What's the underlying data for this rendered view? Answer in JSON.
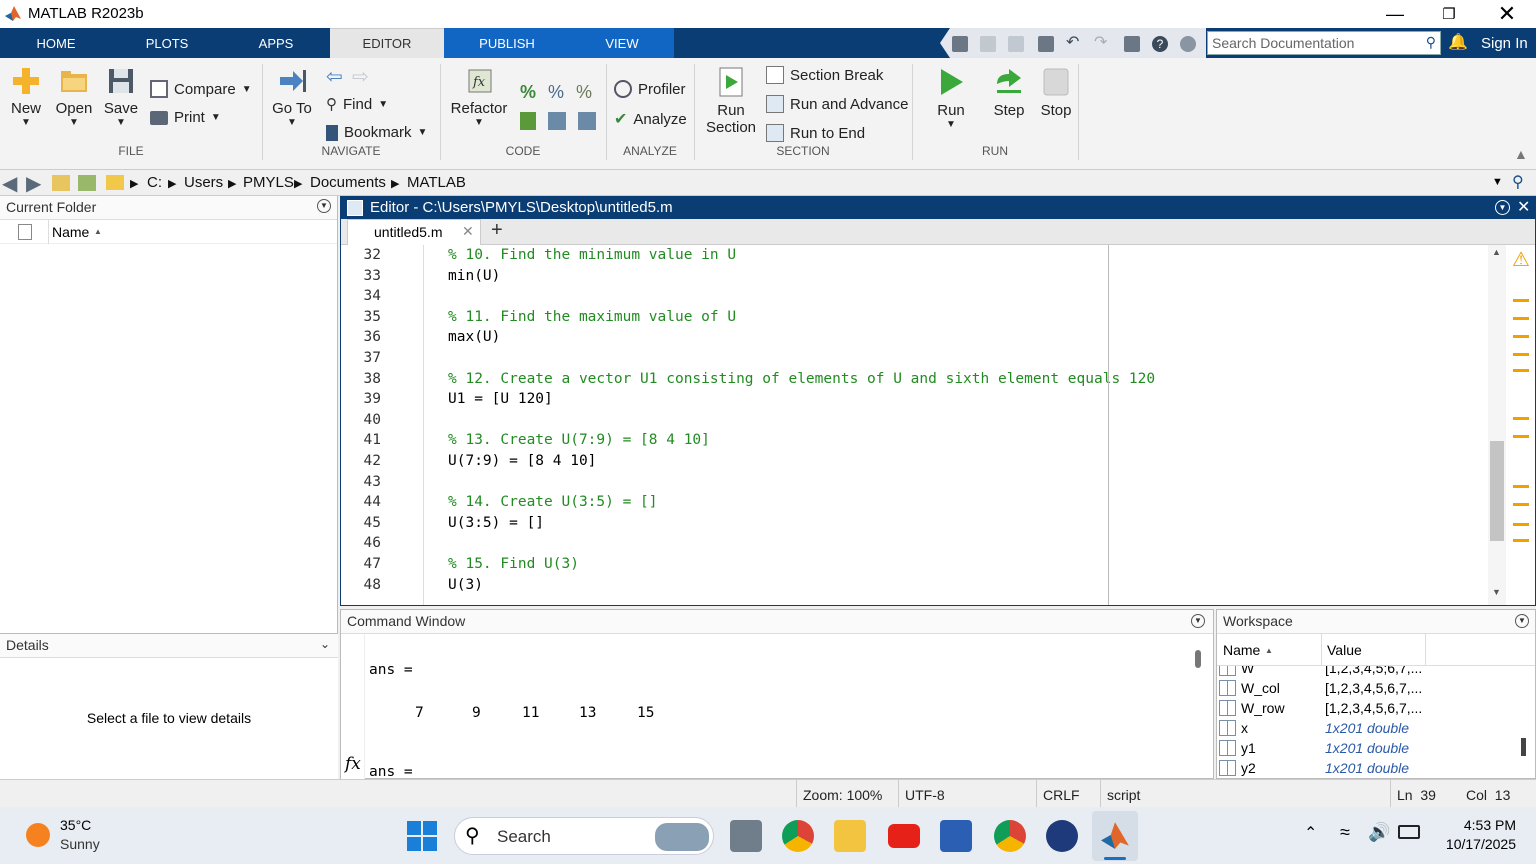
{
  "window": {
    "title": "MATLAB R2023b"
  },
  "ribbon_tabs": [
    "HOME",
    "PLOTS",
    "APPS",
    "EDITOR",
    "PUBLISH",
    "VIEW"
  ],
  "search": {
    "placeholder": "Search Documentation"
  },
  "sign_in": "Sign In",
  "ribbon": {
    "file": {
      "new": "New",
      "open": "Open",
      "save": "Save",
      "compare": "Compare",
      "print": "Print",
      "section": "FILE"
    },
    "navigate": {
      "goto": "Go To",
      "find": "Find",
      "bookmark": "Bookmark",
      "section": "NAVIGATE"
    },
    "code": {
      "refactor": "Refactor",
      "section": "CODE"
    },
    "analyze": {
      "profiler": "Profiler",
      "analyze": "Analyze",
      "section": "ANALYZE"
    },
    "section_grp": {
      "run_section": "Run",
      "run_section2": "Section",
      "section_break": "Section Break",
      "run_advance": "Run and Advance",
      "run_end": "Run to End",
      "section": "SECTION"
    },
    "run": {
      "run": "Run",
      "step": "Step",
      "stop": "Stop",
      "section": "RUN"
    }
  },
  "path": [
    "C:",
    "Users",
    "PMYLS",
    "Documents",
    "MATLAB"
  ],
  "current_folder": {
    "title": "Current Folder",
    "col_name": "Name"
  },
  "details": {
    "title": "Details",
    "message": "Select a file to view details"
  },
  "editor": {
    "title": "Editor - C:\\Users\\PMYLS\\Desktop\\untitled5.m",
    "tab": "untitled5.m",
    "lines": [
      {
        "n": "32",
        "text": "% 10. Find the minimum value in U",
        "cmt": true
      },
      {
        "n": "33",
        "text": "min(U)",
        "cmt": false
      },
      {
        "n": "34",
        "text": "",
        "cmt": false
      },
      {
        "n": "35",
        "text": "% 11. Find the maximum value of U",
        "cmt": true
      },
      {
        "n": "36",
        "text": "max(U)",
        "cmt": false
      },
      {
        "n": "37",
        "text": "",
        "cmt": false
      },
      {
        "n": "38",
        "text": "% 12. Create a vector U1 consisting of elements of U and sixth element equals 120",
        "cmt": true
      },
      {
        "n": "39",
        "text": "U1 = [U 120]",
        "cmt": false
      },
      {
        "n": "40",
        "text": "",
        "cmt": false
      },
      {
        "n": "41",
        "text": "% 13. Create U(7:9) = [8 4 10]",
        "cmt": true
      },
      {
        "n": "42",
        "text": "U(7:9) = [8 4 10]",
        "cmt": false
      },
      {
        "n": "43",
        "text": "",
        "cmt": false
      },
      {
        "n": "44",
        "text": "% 14. Create U(3:5) = []",
        "cmt": true
      },
      {
        "n": "45",
        "text": "U(3:5) = []",
        "cmt": false
      },
      {
        "n": "46",
        "text": "",
        "cmt": false
      },
      {
        "n": "47",
        "text": "% 15. Find U(3)",
        "cmt": true
      },
      {
        "n": "48",
        "text": "U(3)",
        "cmt": false
      }
    ]
  },
  "command_window": {
    "title": "Command Window",
    "ans_label": "ans =",
    "values": [
      "7",
      "9",
      "11",
      "13",
      "15"
    ],
    "fx": "fx"
  },
  "workspace": {
    "title": "Workspace",
    "col_name": "Name",
    "col_value": "Value",
    "rows": [
      {
        "name": "W",
        "value": "[1,2,3,4,5;6,7,...",
        "italic": false
      },
      {
        "name": "W_col",
        "value": "[1,2,3,4,5,6,7,...",
        "italic": false
      },
      {
        "name": "W_row",
        "value": "[1,2,3,4,5,6,7,...",
        "italic": false
      },
      {
        "name": "x",
        "value": "1x201 double",
        "italic": true
      },
      {
        "name": "y1",
        "value": "1x201 double",
        "italic": true
      },
      {
        "name": "y2",
        "value": "1x201 double",
        "italic": true
      }
    ]
  },
  "status": {
    "zoom": "Zoom: 100%",
    "encoding": "UTF-8",
    "eol": "CRLF",
    "type": "script",
    "ln": "Ln  39",
    "col": "Col  13"
  },
  "taskbar": {
    "temp": "35°C",
    "weather": "Sunny",
    "search": "Search",
    "time": "4:53 PM",
    "date": "10/17/2025"
  }
}
